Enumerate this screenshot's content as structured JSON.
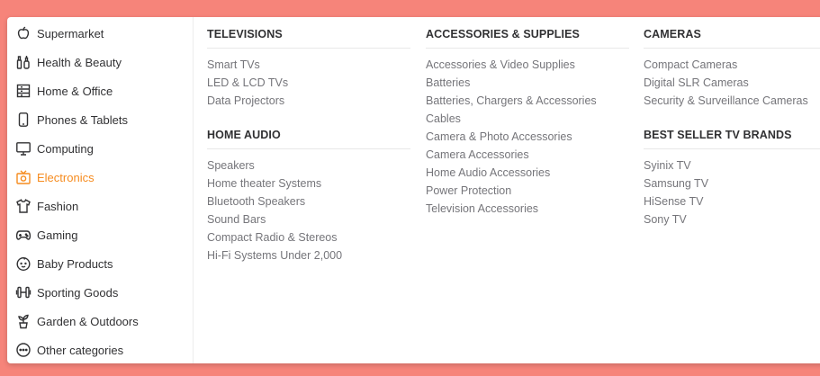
{
  "categories": [
    {
      "label": "Supermarket",
      "icon": "apple-icon",
      "active": false
    },
    {
      "label": "Health & Beauty",
      "icon": "health-beauty-icon",
      "active": false
    },
    {
      "label": "Home & Office",
      "icon": "home-office-icon",
      "active": false
    },
    {
      "label": "Phones & Tablets",
      "icon": "phone-icon",
      "active": false
    },
    {
      "label": "Computing",
      "icon": "monitor-icon",
      "active": false
    },
    {
      "label": "Electronics",
      "icon": "tv-icon",
      "active": true
    },
    {
      "label": "Fashion",
      "icon": "shirt-icon",
      "active": false
    },
    {
      "label": "Gaming",
      "icon": "gamepad-icon",
      "active": false
    },
    {
      "label": "Baby Products",
      "icon": "baby-icon",
      "active": false
    },
    {
      "label": "Sporting Goods",
      "icon": "dumbbell-icon",
      "active": false
    },
    {
      "label": "Garden & Outdoors",
      "icon": "plant-icon",
      "active": false
    },
    {
      "label": "Other categories",
      "icon": "more-icon",
      "active": false
    }
  ],
  "accent_color": "#f68b1e",
  "columns": [
    {
      "sections": [
        {
          "title": "TELEVISIONS",
          "links": [
            "Smart TVs",
            "LED & LCD TVs",
            "Data Projectors"
          ]
        },
        {
          "title": "HOME AUDIO",
          "links": [
            "Speakers",
            "Home theater Systems",
            "Bluetooth Speakers",
            "Sound Bars",
            "Compact Radio & Stereos",
            "Hi-Fi Systems Under 2,000"
          ]
        }
      ]
    },
    {
      "sections": [
        {
          "title": "ACCESSORIES & SUPPLIES",
          "links": [
            "Accessories & Video Supplies",
            "Batteries",
            "Batteries, Chargers & Accessories",
            "Cables",
            "Camera & Photo Accessories",
            "Camera Accessories",
            "Home Audio Accessories",
            "Power Protection",
            "Television Accessories"
          ]
        }
      ]
    },
    {
      "sections": [
        {
          "title": "CAMERAS",
          "links": [
            "Compact Cameras",
            "Digital SLR Cameras",
            "Security & Surveillance Cameras"
          ]
        },
        {
          "title": "BEST SELLER TV BRANDS",
          "links": [
            "Syinix TV",
            "Samsung TV",
            "HiSense TV",
            "Sony TV"
          ]
        }
      ]
    }
  ]
}
